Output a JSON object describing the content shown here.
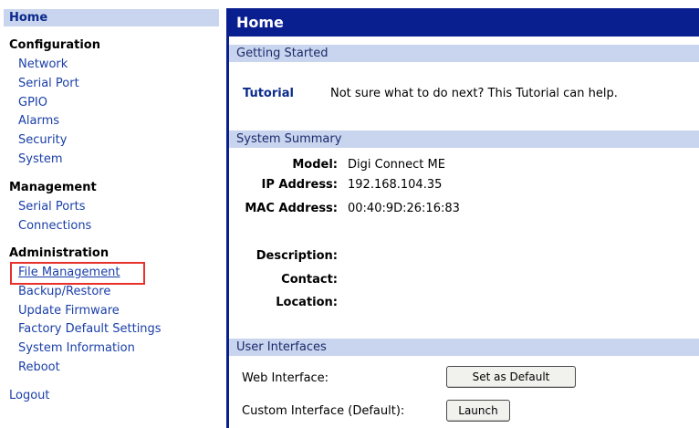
{
  "sidebar": {
    "home": "Home",
    "configuration": {
      "heading": "Configuration",
      "items": [
        "Network",
        "Serial Port",
        "GPIO",
        "Alarms",
        "Security",
        "System"
      ]
    },
    "management": {
      "heading": "Management",
      "items": [
        "Serial Ports",
        "Connections"
      ]
    },
    "administration": {
      "heading": "Administration",
      "items": [
        "File Management",
        "Backup/Restore",
        "Update Firmware",
        "Factory Default Settings",
        "System Information",
        "Reboot"
      ]
    },
    "logout": "Logout"
  },
  "main": {
    "title": "Home",
    "getting_started": {
      "heading": "Getting Started",
      "tutorial_link": "Tutorial",
      "tutorial_text": "Not sure what to do next? This Tutorial can help."
    },
    "system_summary": {
      "heading": "System Summary",
      "model_label": "Model:",
      "model": "Digi Connect ME",
      "ip_label": "IP Address:",
      "ip": "192.168.104.35",
      "mac_label": "MAC Address:",
      "mac": "00:40:9D:26:16:83",
      "description_label": "Description:",
      "contact_label": "Contact:",
      "location_label": "Location:"
    },
    "user_interfaces": {
      "heading": "User Interfaces",
      "web_label": "Web Interface:",
      "web_button": "Set as Default",
      "custom_label": "Custom Interface (Default):",
      "custom_button": "Launch"
    }
  },
  "colors": {
    "header_blue": "#0a1f8f",
    "section_bg": "#c9d4ee",
    "link_blue": "#1a3fa8",
    "highlight_red": "#e8312b"
  }
}
